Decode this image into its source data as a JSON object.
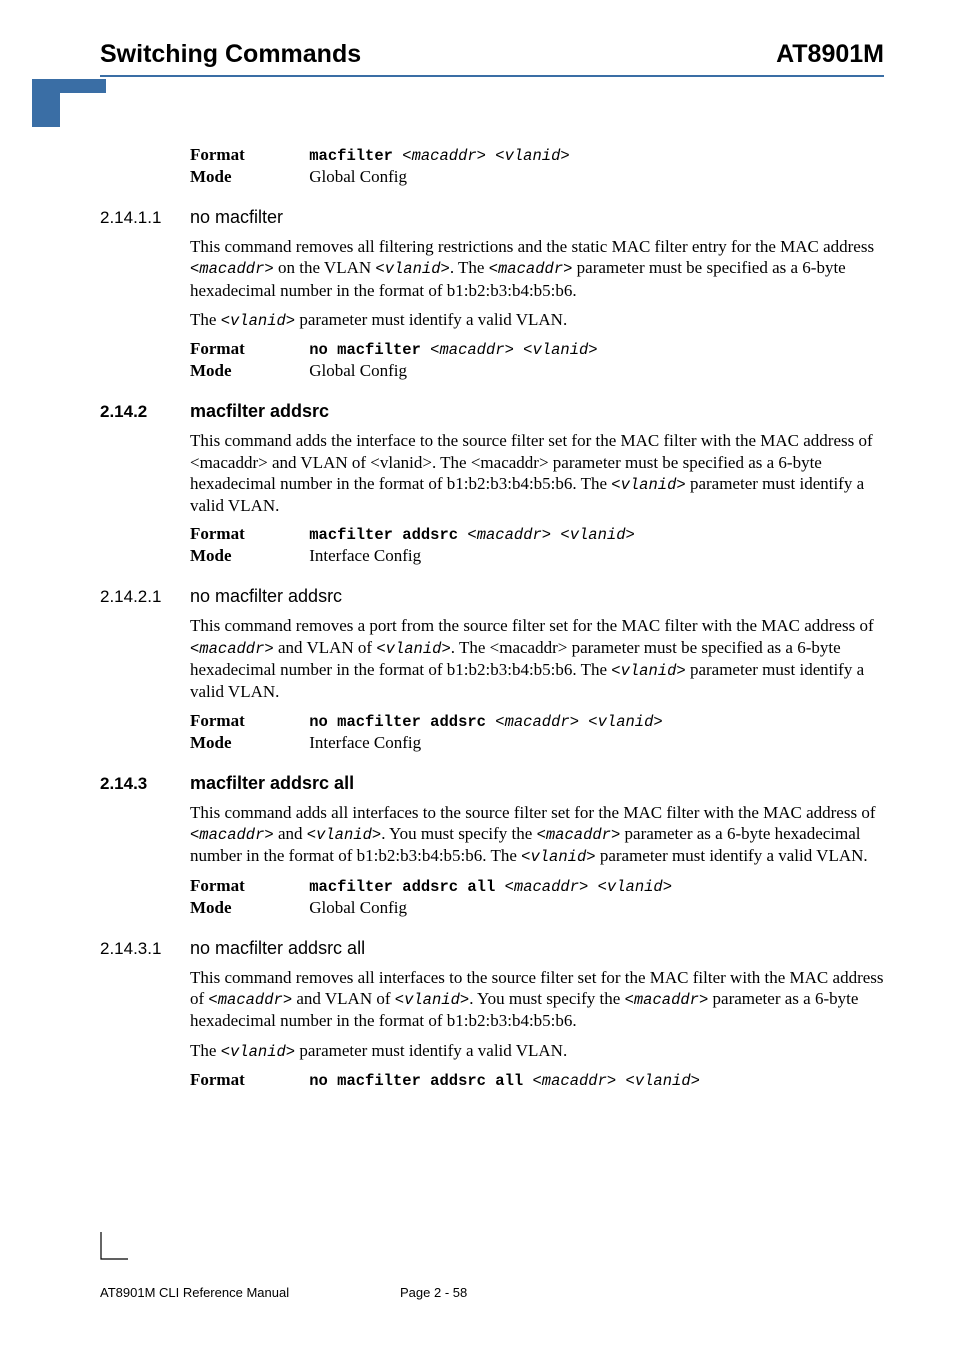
{
  "header": {
    "left": "Switching Commands",
    "right": "AT8901M"
  },
  "labels": {
    "format": "Format",
    "mode": "Mode",
    "globalConfig": "Global Config",
    "interfaceConfig": "Interface Config"
  },
  "s0": {
    "fmt_b": "macfilter ",
    "fmt_i": "<macaddr> <vlanid>"
  },
  "s1": {
    "num": "2.14.1.1",
    "title": "no macfilter",
    "p1a": "This command removes all filtering restrictions and the static MAC filter entry for the MAC address ",
    "p1b": "<macaddr>",
    "p1c": " on the VLAN ",
    "p1d": "<vlanid>",
    "p1e": ". The ",
    "p1f": "<macaddr>",
    "p1g": " parameter must be specified as a 6-byte hexadecimal number in the format of b1:b2:b3:b4:b5:b6.",
    "p2a": "The ",
    "p2b": "<vlanid>",
    "p2c": " parameter must identify a valid VLAN.",
    "fmt_b": "no macfilter ",
    "fmt_i": "<macaddr> <vlanid>"
  },
  "s2": {
    "num": "2.14.2",
    "title": "macfilter addsrc",
    "p1a": "This command adds the interface to the source filter set for the MAC filter with the MAC address of <macaddr> and VLAN of <vlanid>. The <macaddr> parameter must be specified as a 6-byte hexadecimal number in the format of b1:b2:b3:b4:b5:b6. The ",
    "p1b": "<vlanid>",
    "p1c": " parameter must identify a valid VLAN.",
    "fmt_b": "macfilter addsrc ",
    "fmt_i": "<macaddr> <vlanid>"
  },
  "s3": {
    "num": "2.14.2.1",
    "title": "no macfilter addsrc",
    "p1a": "This command removes a port from the source filter set for the MAC filter with the MAC address of ",
    "p1b": "<macaddr>",
    "p1c": "  and VLAN of ",
    "p1d": "<vlanid>",
    "p1e": ".   The <macaddr> parameter must be specified as a 6-byte hexadecimal number in the format of b1:b2:b3:b4:b5:b6. The ",
    "p1f": "<vlanid>",
    "p1g": " parameter must identify a valid VLAN.",
    "fmt_b": "no macfilter addsrc ",
    "fmt_i": "<macaddr> <vlanid>"
  },
  "s4": {
    "num": "2.14.3",
    "title": "macfilter addsrc all",
    "p1a": "This command adds all interfaces to the source filter set for the MAC filter with the MAC address of ",
    "p1b": "<macaddr>",
    "p1c": " and ",
    "p1d": "<vlanid>",
    "p1e": ". You must specify the  ",
    "p1f": "<macaddr>",
    "p1g": " parameter as a 6-byte hexadecimal number in the format of b1:b2:b3:b4:b5:b6. The ",
    "p1h": "<vlanid>",
    "p1i": " parameter must identify a valid VLAN.",
    "fmt_b": "macfilter addsrc all ",
    "fmt_i": "<macaddr> <vlanid>"
  },
  "s5": {
    "num": "2.14.3.1",
    "title": "no macfilter addsrc all",
    "p1a": "This command removes all interfaces to the source filter set for the MAC filter with the MAC address of ",
    "p1b": "<macaddr>",
    "p1c": " and VLAN of ",
    "p1d": "<vlanid>",
    "p1e": ". You must specify the ",
    "p1f": "<macaddr>",
    "p1g": " parameter as a 6-byte hexadecimal number in the format of b1:b2:b3:b4:b5:b6.",
    "p2a": "The ",
    "p2b": "<vlanid>",
    "p2c": " parameter must identify a valid VLAN.",
    "fmt_b": "no macfilter addsrc all ",
    "fmt_i": "<macaddr> <vlanid>"
  },
  "footer": {
    "left": "AT8901M CLI Reference Manual",
    "page": "Page 2 - 58"
  }
}
